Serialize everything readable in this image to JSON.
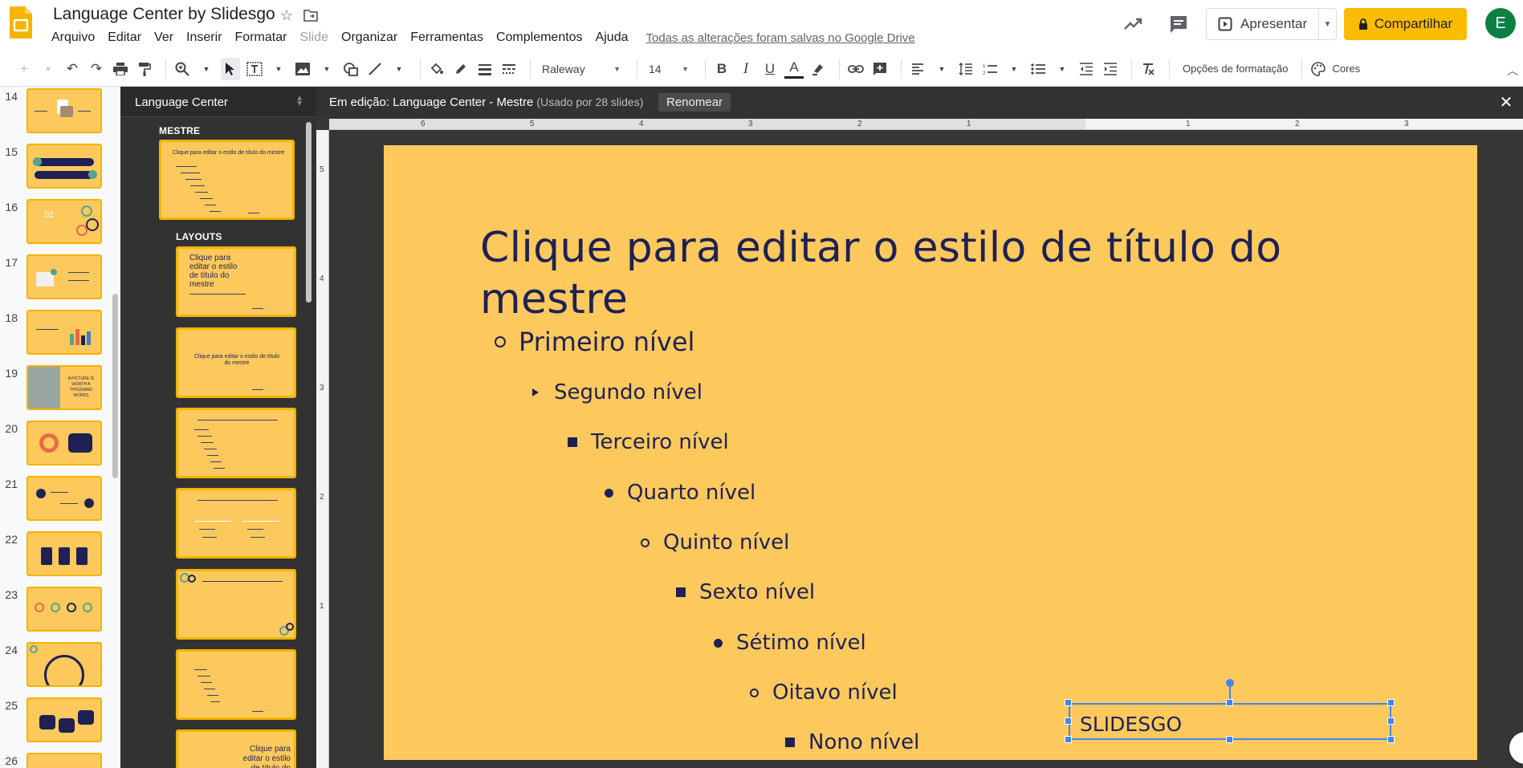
{
  "app": {
    "title": "Language Center by Slidesgo",
    "save_status": "Todas as alterações foram salvas no Google Drive"
  },
  "menu": [
    {
      "label": "Arquivo",
      "enabled": true
    },
    {
      "label": "Editar",
      "enabled": true
    },
    {
      "label": "Ver",
      "enabled": true
    },
    {
      "label": "Inserir",
      "enabled": true
    },
    {
      "label": "Formatar",
      "enabled": true
    },
    {
      "label": "Slide",
      "enabled": false
    },
    {
      "label": "Organizar",
      "enabled": true
    },
    {
      "label": "Ferramentas",
      "enabled": true
    },
    {
      "label": "Complementos",
      "enabled": true
    },
    {
      "label": "Ajuda",
      "enabled": true
    }
  ],
  "header_actions": {
    "present_label": "Apresentar",
    "share_label": "Compartilhar",
    "avatar_letter": "E"
  },
  "toolbar": {
    "font": "Raleway",
    "font_size": "14",
    "format_options": "Opções de formatação",
    "colors": "Cores"
  },
  "filmstrip": {
    "slides": [
      {
        "num": "14"
      },
      {
        "num": "15"
      },
      {
        "num": "16",
        "text": "02"
      },
      {
        "num": "17"
      },
      {
        "num": "18"
      },
      {
        "num": "19",
        "text": "A PICTURE IS WORTH A THOUSAND WORDS"
      },
      {
        "num": "20"
      },
      {
        "num": "21"
      },
      {
        "num": "22"
      },
      {
        "num": "23"
      },
      {
        "num": "24"
      },
      {
        "num": "25"
      },
      {
        "num": "26"
      }
    ]
  },
  "master_panel": {
    "title": "Language Center",
    "master_label": "MESTRE",
    "layouts_label": "LAYOUTS",
    "master_thumb_title": "Clique para editar o estilo de título do mestre",
    "layout1_title": "Clique para editar o estilo de título do mestre",
    "layout2_title": "Clique para editar o estilo de título do mestre",
    "layout_last_title": "Clique para editar o estilo de título do"
  },
  "edit_banner": {
    "label": "Em edição: Language Center - Mestre",
    "usage": "(Usado por 28 slides)",
    "rename": "Renomear",
    "close": "✕"
  },
  "ruler": {
    "h": [
      "6",
      "5",
      "4",
      "3",
      "2",
      "1",
      "1",
      "2",
      "3"
    ],
    "v": [
      "5",
      "4",
      "3",
      "2",
      "1"
    ]
  },
  "slide": {
    "title": "Clique para editar o estilo de título do mestre",
    "levels": [
      {
        "text": "Primeiro nível",
        "bullet": "circle"
      },
      {
        "text": "Segundo nível",
        "bullet": "tri"
      },
      {
        "text": "Terceiro nível",
        "bullet": "square"
      },
      {
        "text": "Quarto nível",
        "bullet": "disc"
      },
      {
        "text": "Quinto nível",
        "bullet": "circle"
      },
      {
        "text": "Sexto nível",
        "bullet": "square"
      },
      {
        "text": "Sétimo nível",
        "bullet": "disc"
      },
      {
        "text": "Oitavo nível",
        "bullet": "circle"
      },
      {
        "text": "Nono nível",
        "bullet": "square"
      }
    ],
    "footer_text": "SLIDESGO"
  },
  "colors": {
    "slide_bg": "#fdc95d",
    "slide_text": "#1f2154",
    "accent_yellow": "#fbbc04",
    "selection_blue": "#4285f4",
    "panel_dark": "#323232"
  }
}
